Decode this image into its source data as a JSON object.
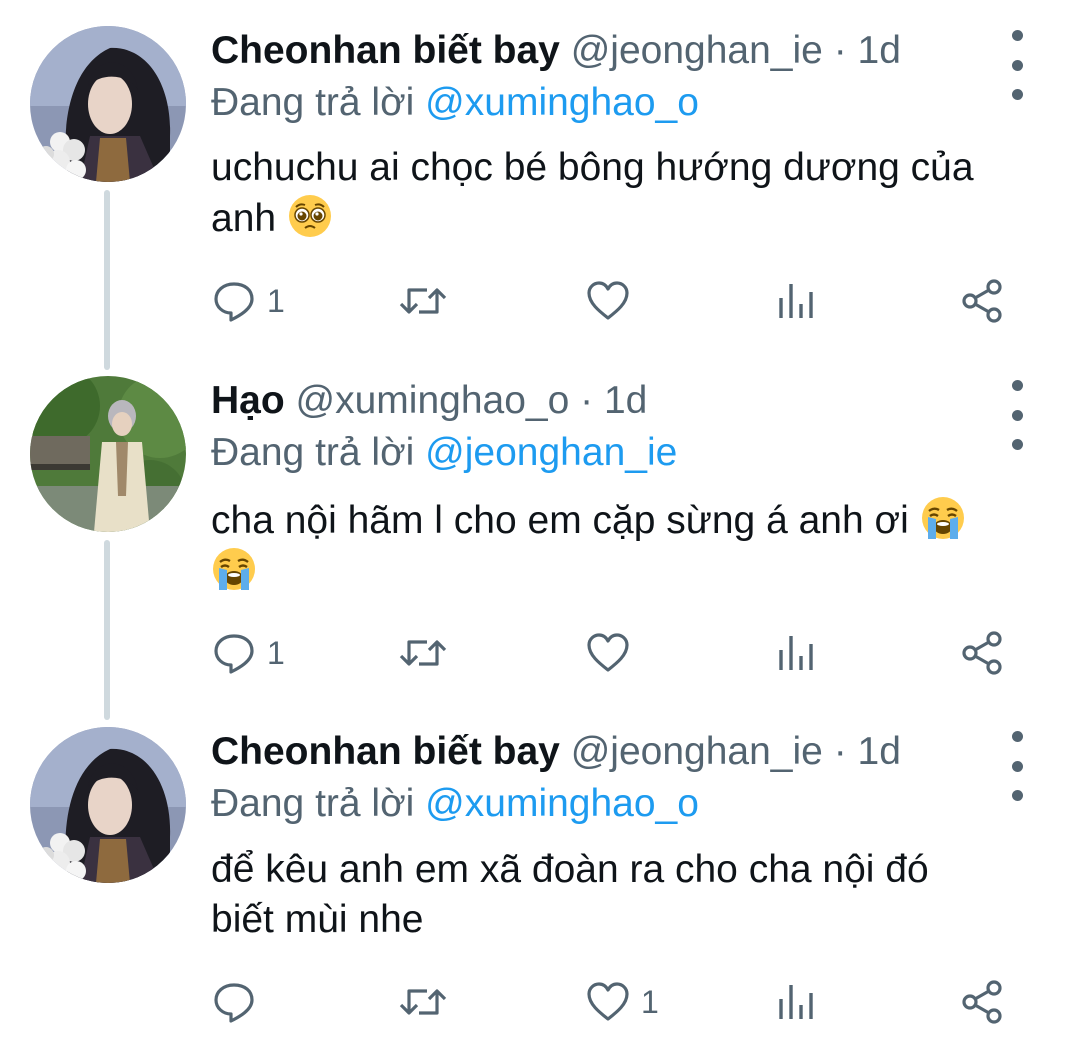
{
  "tweets": [
    {
      "display_name": "Cheonhan biết bay",
      "handle": "@jeonghan_ie",
      "separator": "·",
      "time": "1d",
      "replying_prefix": "Đang trả lời",
      "replying_to": "@xuminghao_o",
      "text_line1": "uchuchu ai chọc bé bông hướng dương của",
      "text_line2": "anh",
      "emoji": "pleading-face",
      "reply_count": "1",
      "retweet_count": "",
      "like_count": ""
    },
    {
      "display_name": "Hạo",
      "handle": "@xuminghao_o",
      "separator": "·",
      "time": "1d",
      "replying_prefix": "Đang trả lời",
      "replying_to": "@jeonghan_ie",
      "text_line1": "cha nội hãm l cho em cặp sừng á anh ơi",
      "text_line2": "",
      "emoji": "loudly-crying-face",
      "reply_count": "1",
      "retweet_count": "",
      "like_count": ""
    },
    {
      "display_name": "Cheonhan biết bay",
      "handle": "@jeonghan_ie",
      "separator": "·",
      "time": "1d",
      "replying_prefix": "Đang trả lời",
      "replying_to": "@xuminghao_o",
      "text_line1": "để kêu anh em xã đoàn ra cho cha nội đó",
      "text_line2": "biết mùi nhe",
      "emoji": "",
      "reply_count": "",
      "retweet_count": "",
      "like_count": "1"
    }
  ],
  "colors": {
    "text_primary": "#0f1419",
    "text_secondary": "#536471",
    "link": "#1d9bf0",
    "thread_line": "#cfd9de"
  },
  "icons": [
    "reply-icon",
    "retweet-icon",
    "like-icon",
    "analytics-icon",
    "share-icon",
    "more-icon"
  ]
}
